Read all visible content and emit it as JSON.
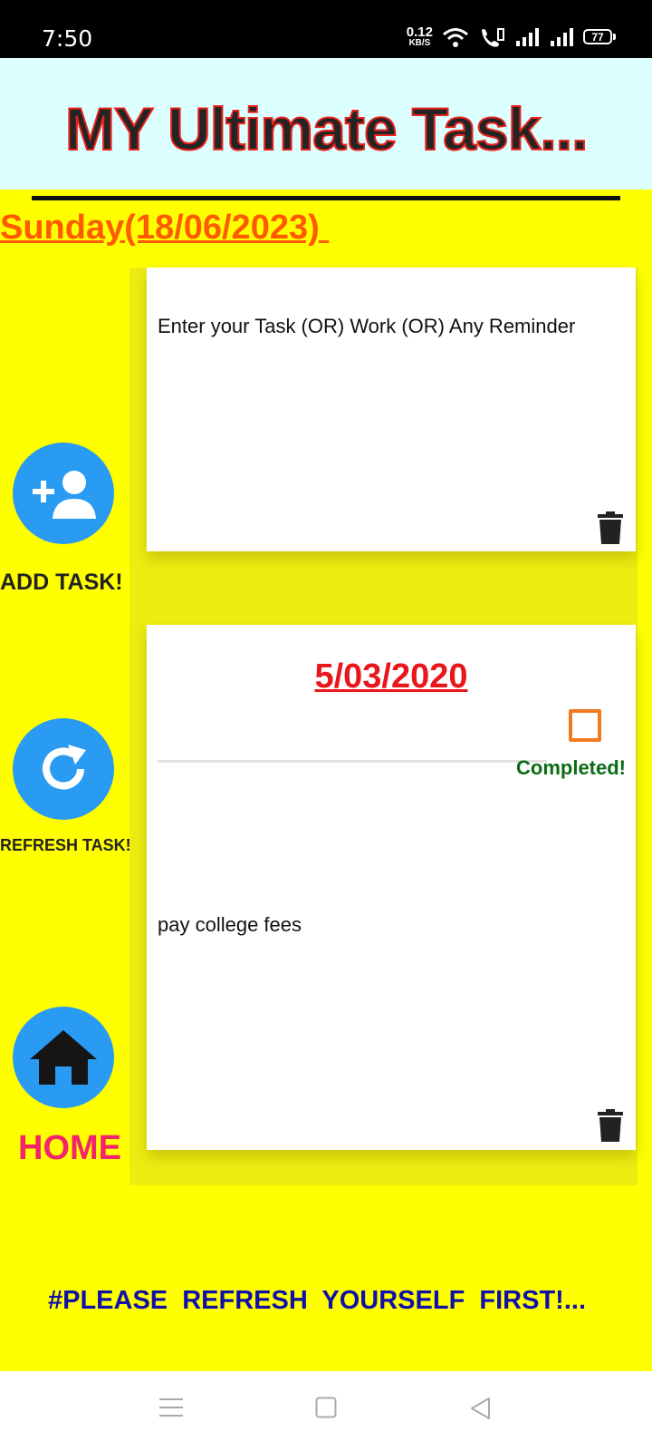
{
  "status_bar": {
    "time": "7:50",
    "net_speed": "0.12",
    "net_unit": "KB/S",
    "battery": "77",
    "icons": [
      "wifi-icon",
      "call-signal-icon",
      "signal-icon",
      "signal-icon"
    ]
  },
  "header": {
    "title": "MY Ultimate Task..."
  },
  "date_label": "Sunday(18/06/2023) ",
  "side_actions": {
    "add_label": "ADD TASK!",
    "refresh_label": "REFRESH TASK!",
    "home_label": "HOME"
  },
  "tasks": [
    {
      "text": "Enter your Task (OR) Work (OR) Any Reminder"
    },
    {
      "date": "5/03/2020",
      "completed_label": "Completed!",
      "text": "pay college fees"
    }
  ],
  "footer_note": "#PLEASE  REFRESH  YOURSELF  FIRST!...",
  "colors": {
    "background": "#ffff00",
    "header_bg": "#dcffff",
    "fab_blue": "#2a9bf3",
    "date_orange": "#ff5a00",
    "task_date_red": "#e8171b",
    "completed_green": "#0a6b14",
    "home_pink": "#f2256b",
    "footer_blue": "#1010a8"
  }
}
